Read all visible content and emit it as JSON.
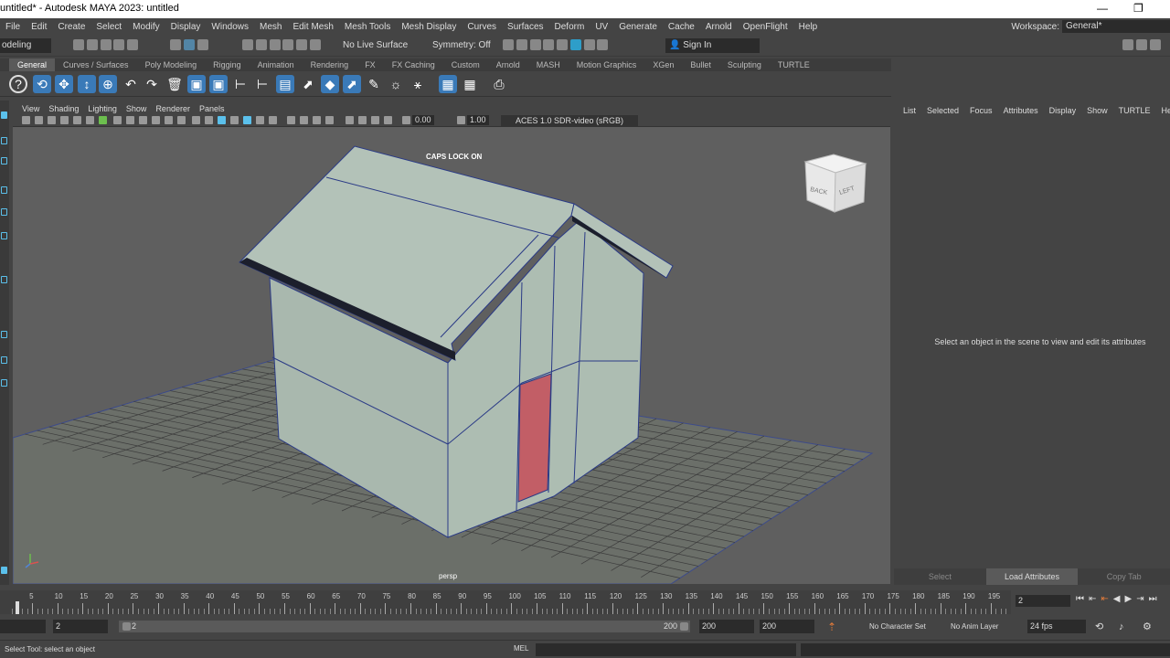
{
  "window": {
    "title": "untitled* - Autodesk MAYA 2023: untitled",
    "min_icon": "—",
    "restore_icon": "❐"
  },
  "menus": [
    "File",
    "Edit",
    "Create",
    "Select",
    "Modify",
    "Display",
    "Windows",
    "Mesh",
    "Edit Mesh",
    "Mesh Tools",
    "Mesh Display",
    "Curves",
    "Surfaces",
    "Deform",
    "UV",
    "Generate",
    "Cache",
    "Arnold",
    "OpenFlight",
    "Help"
  ],
  "workspace": {
    "label": "Workspace:",
    "value": "General*"
  },
  "statusline": {
    "menuset": "odeling",
    "live_surface": "No Live Surface",
    "symmetry": "Symmetry: Off",
    "sign_in": "Sign In"
  },
  "shelf_tabs": [
    "General",
    "Curves / Surfaces",
    "Poly Modeling",
    "Rigging",
    "Animation",
    "Rendering",
    "FX",
    "FX Caching",
    "Custom",
    "Arnold",
    "MASH",
    "Motion Graphics",
    "XGen",
    "Bullet",
    "Sculpting",
    "TURTLE"
  ],
  "shelf_active": "General",
  "viewport_menu": [
    "View",
    "Shading",
    "Lighting",
    "Show",
    "Renderer",
    "Panels"
  ],
  "panel_toolbar": {
    "exposure": "0.00",
    "gamma": "1.00",
    "color_space": "ACES 1.0 SDR-video (sRGB)"
  },
  "viewport": {
    "caps_message": "CAPS LOCK ON",
    "camera_label": "persp",
    "viewcube_faces": [
      "BACK",
      "LEFT"
    ],
    "door_color": "#c25e66",
    "house_color": "#a9b8ae"
  },
  "attribute_editor": {
    "menu": [
      "List",
      "Selected",
      "Focus",
      "Attributes",
      "Display",
      "Show",
      "TURTLE",
      "Help"
    ],
    "message": "Select an object in the scene to view and edit its attributes",
    "buttons": [
      "Select",
      "Load Attributes",
      "Copy Tab"
    ]
  },
  "timeline": {
    "tick_labels": [
      "5",
      "10",
      "15",
      "20",
      "25",
      "30",
      "35",
      "40",
      "45",
      "50",
      "55",
      "60",
      "65",
      "70",
      "75",
      "80",
      "85",
      "90",
      "95",
      "100",
      "105",
      "110",
      "115",
      "120",
      "125",
      "130",
      "135",
      "140",
      "145",
      "150",
      "155",
      "160",
      "165",
      "170",
      "175",
      "180",
      "185",
      "190",
      "195",
      "200"
    ],
    "current_frame": "2"
  },
  "range": {
    "start": "2",
    "slider_start": "2",
    "slider_end": "200",
    "end": "200",
    "anim_end": "200",
    "character_set": "No Character Set",
    "anim_layer": "No Anim Layer",
    "fps": "24 fps"
  },
  "help_line": {
    "message": "Select Tool: select an object",
    "script_lang": "MEL"
  }
}
